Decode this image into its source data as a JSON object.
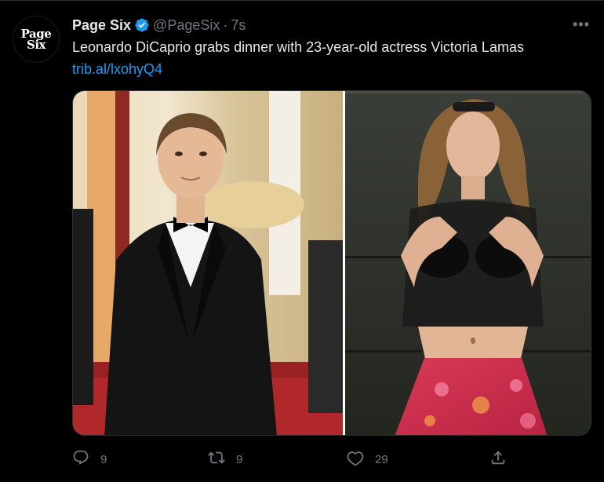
{
  "tweet": {
    "avatar_line1": "Page",
    "avatar_line2": "Six",
    "author_name": "Page Six",
    "handle": "@PageSix",
    "separator": "·",
    "time": "7s",
    "text": "Leonardo DiCaprio grabs dinner with 23-year-old actress Victoria Lamas",
    "link": "trib.al/lxohyQ4",
    "more_label": "•••"
  },
  "actions": {
    "reply_count": "9",
    "retweet_count": "9",
    "like_count": "29"
  },
  "colors": {
    "background": "#000000",
    "text": "#e7e9ea",
    "muted": "#71767b",
    "link": "#1d9bf0",
    "verified": "#1d9bf0",
    "divider": "#2f3336"
  },
  "icons": [
    "verified-badge-icon",
    "more-icon",
    "reply-icon",
    "retweet-icon",
    "like-icon",
    "share-icon"
  ]
}
